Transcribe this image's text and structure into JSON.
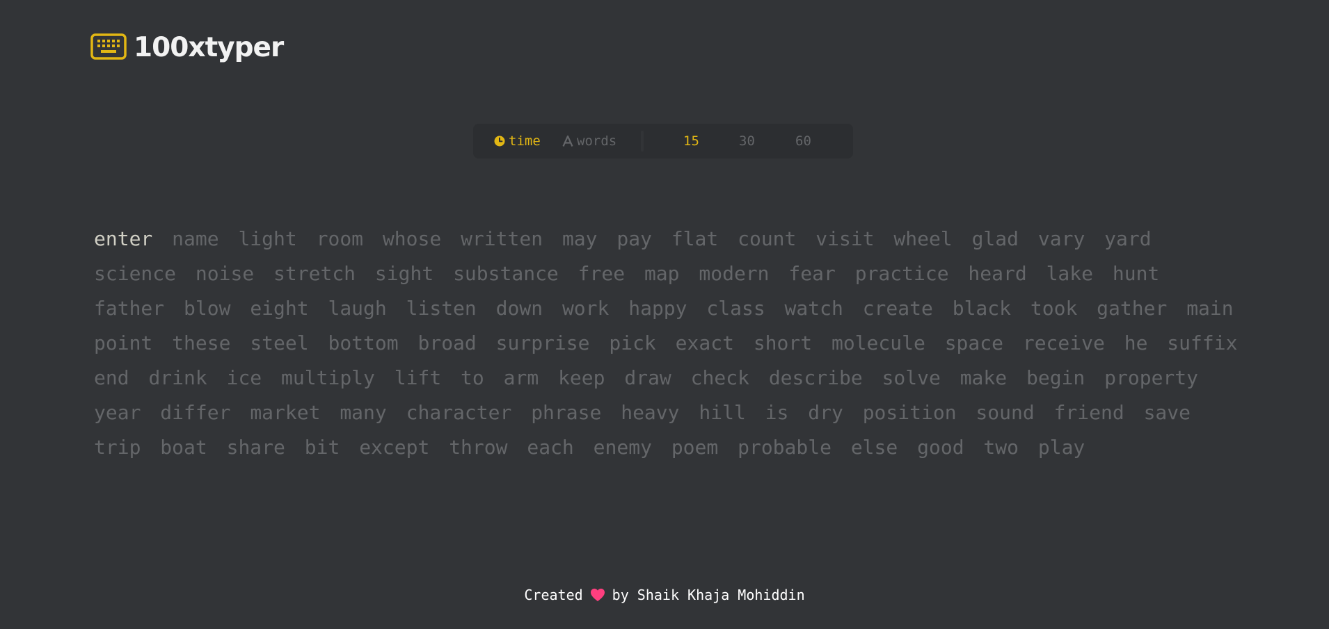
{
  "app": {
    "title": "100xtyper",
    "logo_icon": "keyboard-icon",
    "accent_color": "#e2b714",
    "background_color": "#323437",
    "text_color_untyped": "#646669",
    "text_color_active": "#d1d0c5"
  },
  "config": {
    "modes": [
      {
        "label": "time",
        "icon": "clock-icon",
        "active": true
      },
      {
        "label": "words",
        "icon": "letter-a-icon",
        "active": false
      }
    ],
    "durations": [
      {
        "label": "15",
        "active": true
      },
      {
        "label": "30",
        "active": false
      },
      {
        "label": "60",
        "active": false
      }
    ]
  },
  "test": {
    "current_word_index": 0,
    "words": [
      "enter",
      "name",
      "light",
      "room",
      "whose",
      "written",
      "may",
      "pay",
      "flat",
      "count",
      "visit",
      "wheel",
      "glad",
      "vary",
      "yard",
      "science",
      "noise",
      "stretch",
      "sight",
      "substance",
      "free",
      "map",
      "modern",
      "fear",
      "practice",
      "heard",
      "lake",
      "hunt",
      "father",
      "blow",
      "eight",
      "laugh",
      "listen",
      "down",
      "work",
      "happy",
      "class",
      "watch",
      "create",
      "black",
      "took",
      "gather",
      "main",
      "point",
      "these",
      "steel",
      "bottom",
      "broad",
      "surprise",
      "pick",
      "exact",
      "short",
      "molecule",
      "space",
      "receive",
      "he",
      "suffix",
      "end",
      "drink",
      "ice",
      "multiply",
      "lift",
      "to",
      "arm",
      "keep",
      "draw",
      "check",
      "describe",
      "solve",
      "make",
      "begin",
      "property",
      "year",
      "differ",
      "market",
      "many",
      "character",
      "phrase",
      "heavy",
      "hill",
      "is",
      "dry",
      "position",
      "sound",
      "friend",
      "save",
      "trip",
      "boat",
      "share",
      "bit",
      "except",
      "throw",
      "each",
      "enemy",
      "poem",
      "probable",
      "else",
      "good",
      "two",
      "play"
    ]
  },
  "footer": {
    "prefix": "Created",
    "heart_icon": "heart-icon",
    "heart_color": "#ff3f7f",
    "suffix": "by Shaik Khaja Mohiddin"
  }
}
